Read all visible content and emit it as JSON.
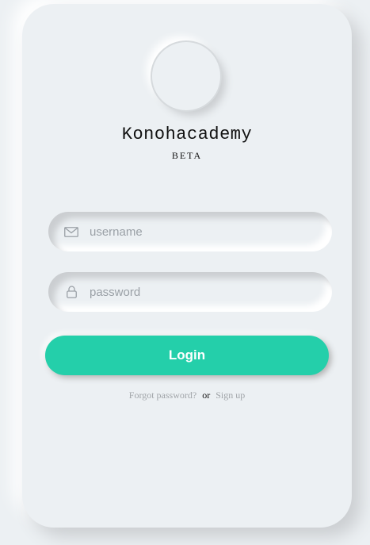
{
  "app": {
    "title": "Konohacademy",
    "subtitle": "BETA"
  },
  "form": {
    "username": {
      "placeholder": "username",
      "value": "",
      "icon": "mail-icon"
    },
    "password": {
      "placeholder": "password",
      "value": "",
      "icon": "lock-icon"
    },
    "login_label": "Login"
  },
  "links": {
    "forgot": "Forgot password?",
    "or": "or",
    "signup": "Sign up"
  },
  "colors": {
    "background": "#ecf0f3",
    "accent": "#24cfaa",
    "muted_text": "#a0a4a8"
  }
}
